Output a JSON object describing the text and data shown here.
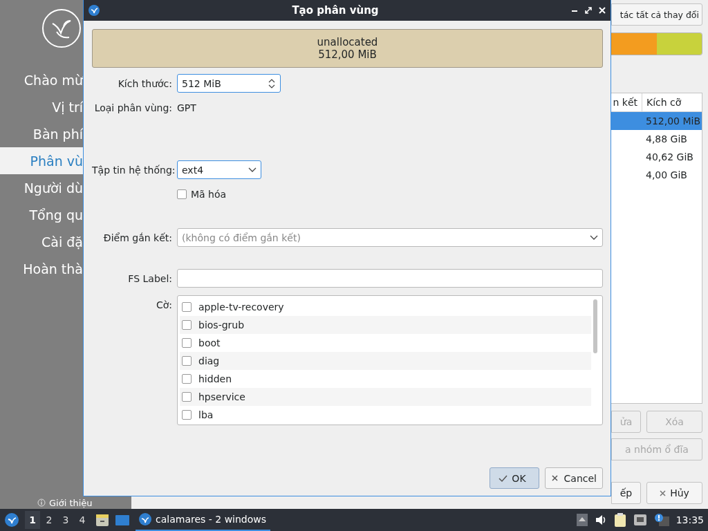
{
  "sidebar": {
    "items": [
      {
        "label": "Chào mừ",
        "selected": false
      },
      {
        "label": "Vị trí",
        "selected": false
      },
      {
        "label": "Bàn phí",
        "selected": false
      },
      {
        "label": "Phân vù",
        "selected": true
      },
      {
        "label": "Người dù",
        "selected": false
      },
      {
        "label": "Tổng qu",
        "selected": false
      },
      {
        "label": "Cài đặ",
        "selected": false
      },
      {
        "label": "Hoàn thà",
        "selected": false
      }
    ],
    "about": "Giới thiệu"
  },
  "dialog": {
    "title": "Tạo phân vùng",
    "preview": {
      "name": "unallocated",
      "size": "512,00 MiB"
    },
    "size": {
      "label": "Kích thước:",
      "value": "512 MiB"
    },
    "partition_type": {
      "label": "Loại phân vùng:",
      "value": "GPT"
    },
    "filesystem": {
      "label": "Tập tin hệ thống:",
      "value": "ext4"
    },
    "encrypt": {
      "label": "Mã hóa",
      "checked": false
    },
    "mount_point": {
      "label": "Điểm gắn kết:",
      "placeholder": "(không có điểm gắn kết)"
    },
    "fs_label": {
      "label": "FS Label:"
    },
    "flags": {
      "label": "Cờ:",
      "items": [
        {
          "label": "apple-tv-recovery",
          "checked": false
        },
        {
          "label": "bios-grub",
          "checked": false
        },
        {
          "label": "boot",
          "checked": false
        },
        {
          "label": "diag",
          "checked": false
        },
        {
          "label": "hidden",
          "checked": false
        },
        {
          "label": "hpservice",
          "checked": false
        },
        {
          "label": "lba",
          "checked": false
        }
      ]
    },
    "buttons": [
      {
        "label": "OK",
        "kind": "ok",
        "default": true
      },
      {
        "label": "Cancel",
        "kind": "cancel",
        "default": false
      }
    ]
  },
  "background": {
    "apply_button": "tác tất cả thay đổi",
    "partition_bar": [
      {
        "color": "#f39c1f"
      },
      {
        "color": "#c8d23c"
      }
    ],
    "table": {
      "columns": [
        "n kết",
        "Kích cỡ"
      ],
      "rows": [
        {
          "size": "512,00 MiB",
          "selected": true
        },
        {
          "size": "4,88 GiB",
          "selected": false
        },
        {
          "size": "40,62 GiB",
          "selected": false
        },
        {
          "size": "4,00 GiB",
          "selected": false
        }
      ]
    },
    "buttons": [
      {
        "label": "ửa",
        "kind": "plain",
        "disabled": true
      },
      {
        "label": "Xóa",
        "kind": "plain",
        "disabled": true
      },
      {
        "label": "a nhóm ổ đĩa",
        "kind": "plain",
        "disabled": true
      },
      {
        "label": "ếp",
        "kind": "plain",
        "disabled": false
      },
      {
        "label": "Hủy",
        "kind": "cancel",
        "disabled": false
      }
    ]
  },
  "taskbar": {
    "workspaces": [
      {
        "label": "1",
        "selected": true
      },
      {
        "label": "2",
        "selected": false
      },
      {
        "label": "3",
        "selected": false
      },
      {
        "label": "4",
        "selected": false
      }
    ],
    "task": "calamares - 2 windows",
    "clock": "13:35"
  }
}
